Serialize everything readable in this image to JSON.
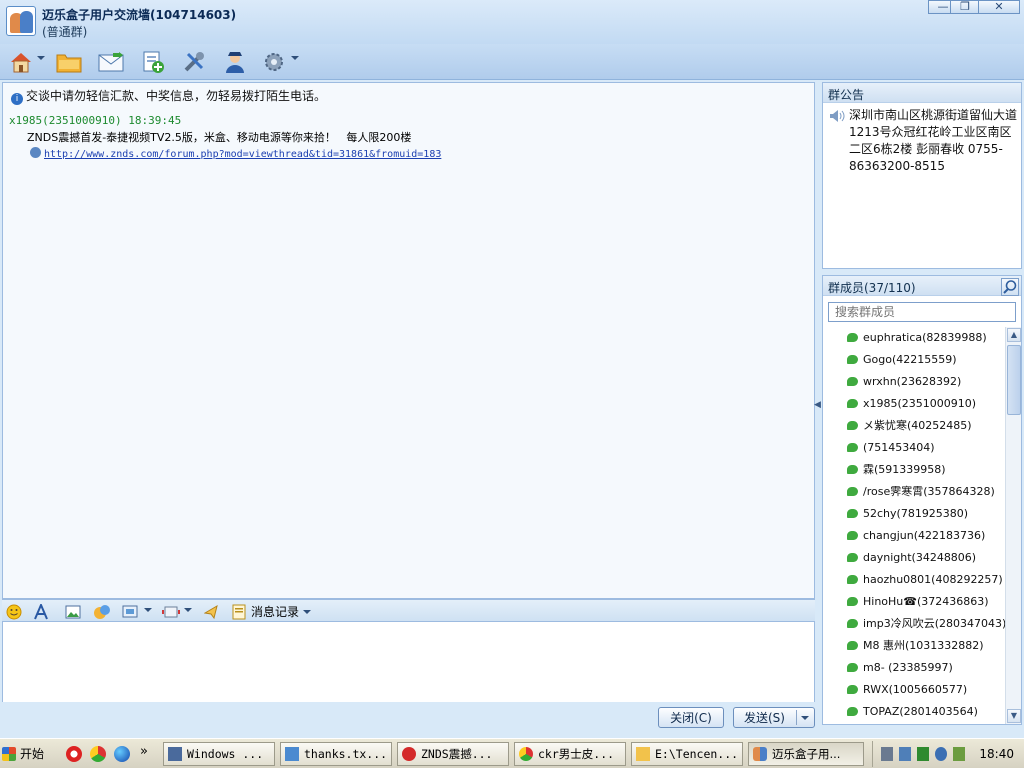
{
  "window": {
    "title": "迈乐盒子用户交流墙(104714603)",
    "subtitle": "(普通群)",
    "controls": [
      "—",
      "❐",
      "✕"
    ]
  },
  "chat": {
    "notice": "交谈中请勿轻信汇款、中奖信息，勿轻易拨打陌生电话。",
    "messages": [
      {
        "sender": "x1985(2351000910)  18:39:45",
        "body": "ZNDS震撼首发-泰捷视频TV2.5版，米盒、移动电源等你来拾！   每人限200楼",
        "link": "http://www.znds.com/forum.php?mod=viewthread&tid=31861&fromuid=183"
      }
    ]
  },
  "compose_bar": {
    "history_label": "消息记录"
  },
  "buttons": {
    "close": "关闭(C)",
    "send": "发送(S)"
  },
  "announcement": {
    "header": "群公告",
    "text": "深圳市南山区桃源街道留仙大道1213号众冠红花岭工业区南区二区6栋2楼 彭丽春收 0755-86363200-8515"
  },
  "members": {
    "header": "群成员(37/110)",
    "search_placeholder": "搜索群成员",
    "list": [
      "euphratica(82839988)",
      "Gogo(42215559)",
      "wrxhn(23628392)",
      "x1985(2351000910)",
      "メ紫忧寒(40252485)",
      "         (751453404)",
      "霖(591339958)",
      "/rose霁寒霄(357864328)",
      "52chy(781925380)",
      "changjun(422183736)",
      "daynight(34248806)",
      "haozhu0801(408292257)",
      "HinoHu☎(372436863)",
      "imp3冷风吹云(280347043)",
      "M8 惠州(1031332882)",
      "m8-          (23385997)",
      "RWX(1005660577)",
      "TOPAZ(2801403564)"
    ]
  },
  "taskbar": {
    "start": "开始",
    "more": "»",
    "tasks": [
      "Windows ...",
      "thanks.tx...",
      "ZNDS震撼...",
      "ckr男士皮...",
      "E:\\Tencen...",
      "迈乐盒子用..."
    ],
    "clock": "18:40"
  }
}
